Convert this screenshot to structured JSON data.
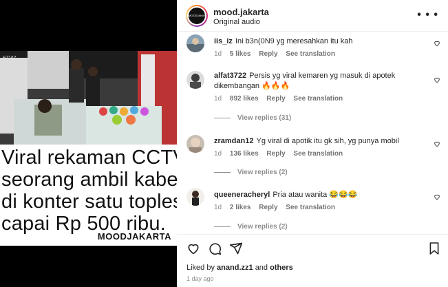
{
  "post": {
    "caption_lines": [
      "Viral rekaman CCTV",
      "seorang ambil kabel",
      "di konter satu toples",
      "capai Rp 500 ribu."
    ],
    "watermark": "MOODJAKARTA",
    "cctv_stamp": "EZVIZ"
  },
  "header": {
    "username": "mood.jakarta",
    "audio": "Original audio",
    "avatar_text": "MOODJAKARTA"
  },
  "comments": [
    {
      "user": "iis_iz",
      "text": "Ini b3n(0N9 yg meresahkan itu kah",
      "time": "1d",
      "likes": "5 likes",
      "reply": "Reply",
      "translate": "See translation"
    },
    {
      "user": "alfat3722",
      "text": "Persis yg viral kemaren yg masuk di apotek dikembangan 🔥🔥🔥",
      "time": "1d",
      "likes": "892 likes",
      "reply": "Reply",
      "translate": "See translation",
      "replies": "View replies (31)"
    },
    {
      "user": "zramdan12",
      "text": "Yg viral di apotik itu gk sih, yg punya mobil",
      "time": "1d",
      "likes": "136 likes",
      "reply": "Reply",
      "translate": "See translation",
      "replies": "View replies (2)"
    },
    {
      "user": "queeneracheryl",
      "text": "Pria atau wanita 😂😂😂",
      "time": "1d",
      "likes": "2 likes",
      "reply": "Reply",
      "translate": "See translation",
      "replies": "View replies (2)"
    }
  ],
  "footer": {
    "liked_prefix": "Liked by",
    "liked_user": "anand.zz1",
    "liked_and": "and",
    "liked_others": "others",
    "time_ago": "1 day ago"
  },
  "icons": [
    "heart-icon",
    "comment-icon",
    "share-icon",
    "bookmark-icon",
    "more-icon"
  ],
  "colors": {
    "muted": "#8e8e8e",
    "text": "#262626",
    "border": "#efefef"
  }
}
